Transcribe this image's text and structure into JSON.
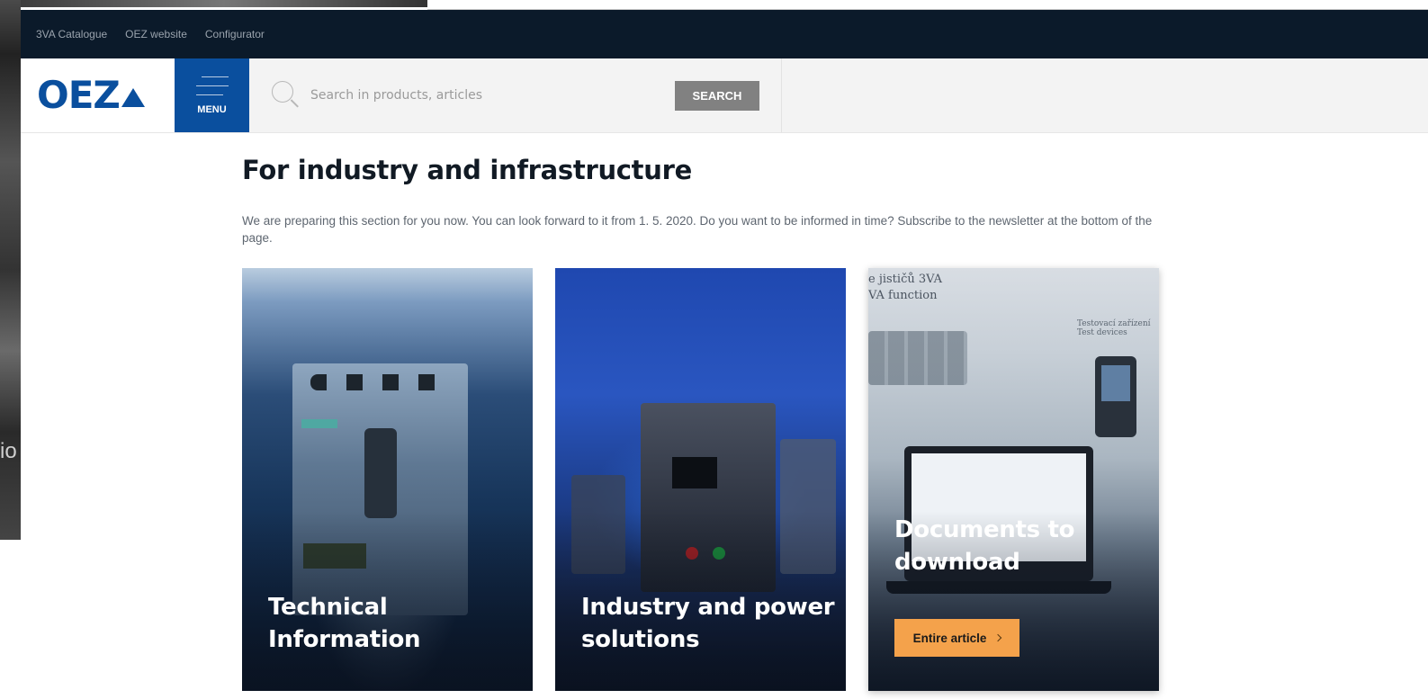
{
  "background": {
    "left_fragment_text": "io"
  },
  "topbar": {
    "links": [
      "3VA Catalogue",
      "OEZ website",
      "Configurator"
    ]
  },
  "header": {
    "logo_text": "OEZ",
    "menu_label": "MENU",
    "search": {
      "placeholder": "Search in products, articles",
      "button_label": "SEARCH"
    }
  },
  "main": {
    "title": "For industry and infrastructure",
    "intro": "We are preparing this section for you now. You can look forward to it from 1. 5. 2020. Do you want to be informed in time? Subscribe to the newsletter at the bottom of the page."
  },
  "cards": [
    {
      "title": "Technical Information"
    },
    {
      "title": "Industry and power solutions"
    },
    {
      "title": "Documents to download",
      "image_text_1": "e jističů 3VA",
      "image_text_2": "VA function",
      "image_text_3": "Testovací zařízení",
      "image_text_4": "Test devices",
      "button_label": "Entire article"
    }
  ],
  "colors": {
    "brand_blue": "#0a4f9e",
    "topbar_bg": "#0b1a2a",
    "button_orange": "#f4a24b",
    "search_button": "#818181"
  }
}
